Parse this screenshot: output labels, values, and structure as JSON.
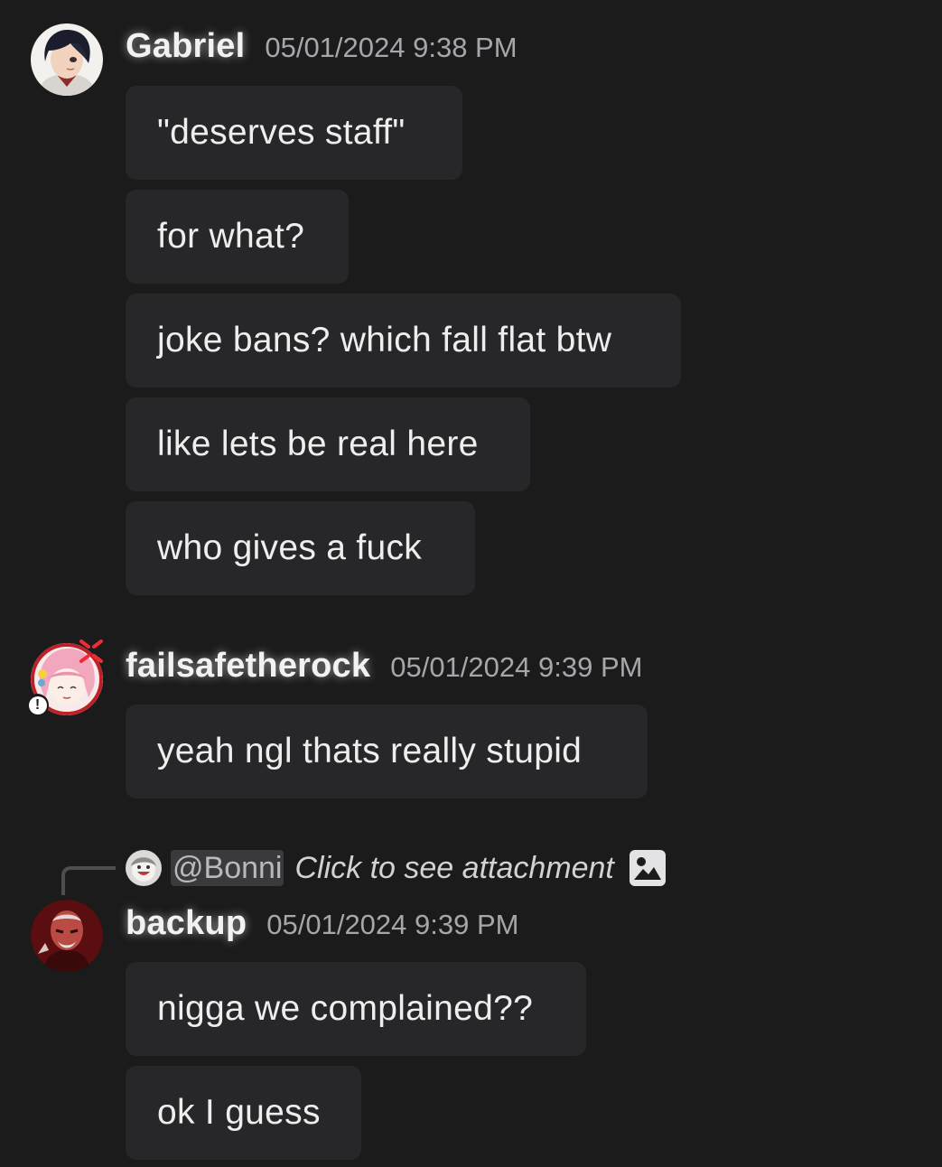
{
  "messages": [
    {
      "user": "Gabriel",
      "time": "05/01/2024 9:38 PM",
      "lines": [
        "\"deserves staff\"",
        "for what?",
        "joke bans? which fall flat btw",
        "like lets be real here",
        "who gives a fuck"
      ]
    },
    {
      "user": "failsafetherock",
      "time": "05/01/2024 9:39 PM",
      "lines": [
        "yeah ngl thats really stupid"
      ]
    },
    {
      "user": "backup",
      "time": "05/01/2024 9:39 PM",
      "reply": {
        "mention": "@Bonni",
        "text": "Click to see attachment",
        "icon": "image-icon"
      },
      "lines": [
        "nigga we complained??",
        "ok I guess"
      ]
    }
  ],
  "badges": {
    "anger_icon": "anger-symbol-icon",
    "status_glyph": "!"
  },
  "colors": {
    "background": "#1b1b1c",
    "bubble": "#272729",
    "username": "#f2f2f3",
    "timestamp": "#a6a6ab"
  }
}
